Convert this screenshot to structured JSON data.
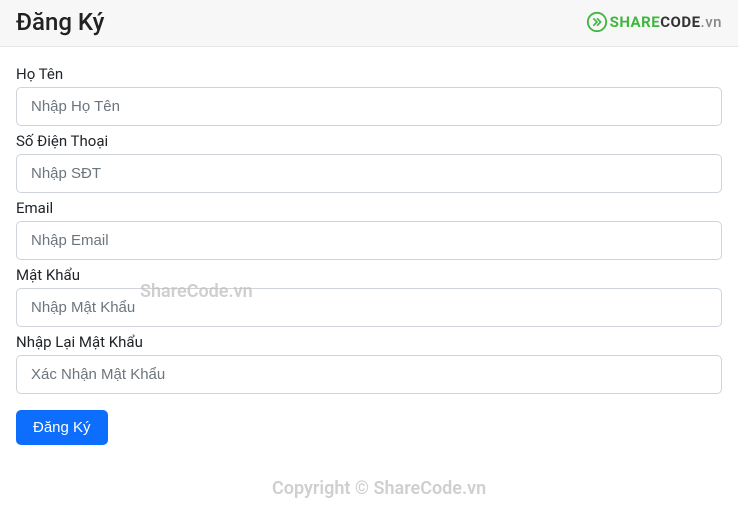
{
  "header": {
    "title": "Đăng Ký",
    "brand": {
      "share": "SHARE",
      "code": "CODE",
      "vn": ".vn"
    }
  },
  "form": {
    "fields": [
      {
        "label": "Họ Tên",
        "placeholder": "Nhập Họ Tên"
      },
      {
        "label": "Số Điện Thoại",
        "placeholder": "Nhập SĐT"
      },
      {
        "label": "Email",
        "placeholder": "Nhập Email"
      },
      {
        "label": "Mật Khẩu",
        "placeholder": "Nhập Mật Khẩu"
      },
      {
        "label": "Nhập Lại Mật Khẩu",
        "placeholder": "Xác Nhận Mật Khẩu"
      }
    ],
    "submit_label": "Đăng Ký"
  },
  "watermarks": {
    "wm1": "ShareCode.vn",
    "wm2": "Copyright © ShareCode.vn"
  }
}
